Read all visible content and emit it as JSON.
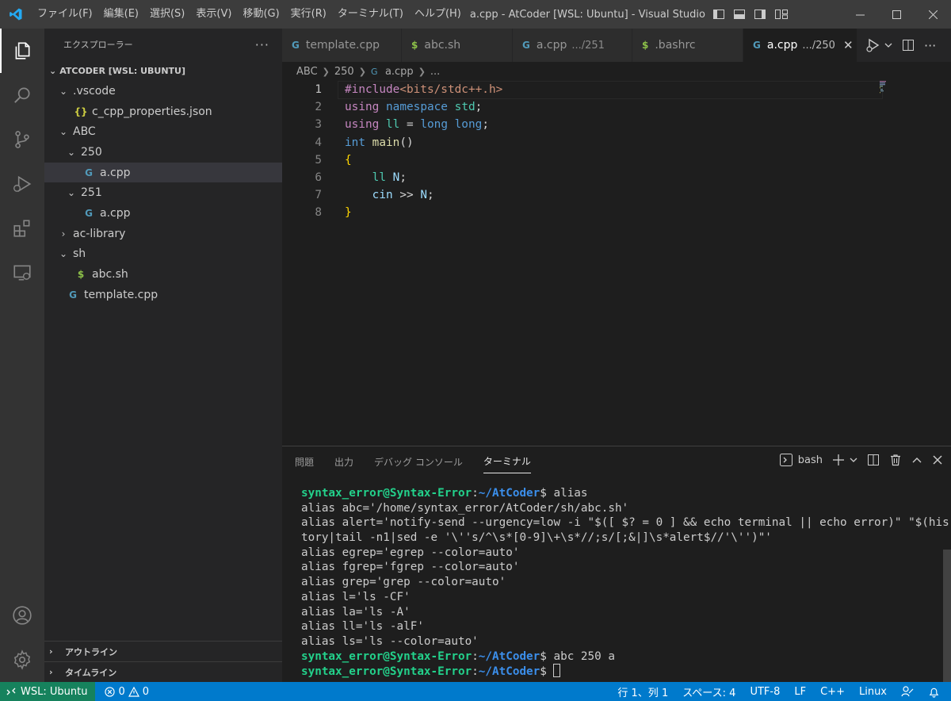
{
  "titlebar": {
    "menu": [
      "ファイル(F)",
      "編集(E)",
      "選択(S)",
      "表示(V)",
      "移動(G)",
      "実行(R)",
      "ターミナル(T)",
      "ヘルプ(H)"
    ],
    "title": "a.cpp - AtCoder [WSL: Ubuntu] - Visual Studio ..."
  },
  "activitybar": {
    "items": [
      "explorer-icon",
      "search-icon",
      "source-control-icon",
      "run-debug-icon",
      "extensions-icon",
      "remote-explorer-icon"
    ],
    "bottom": [
      "account-icon",
      "settings-gear-icon"
    ]
  },
  "sidebar": {
    "header": "エクスプローラー",
    "more": "···",
    "workspace": "ATCODER [WSL: UBUNTU]",
    "tree": [
      {
        "label": ".vscode",
        "indent": 1,
        "twist": "⌄",
        "icon": ""
      },
      {
        "label": "c_cpp_properties.json",
        "indent": 2,
        "twist": "",
        "icon": "{}"
      },
      {
        "label": "ABC",
        "indent": 1,
        "twist": "⌄",
        "icon": ""
      },
      {
        "label": "250",
        "indent": 2,
        "twist": "⌄",
        "icon": ""
      },
      {
        "label": "a.cpp",
        "indent": 3,
        "twist": "",
        "icon": "G"
      },
      {
        "label": "251",
        "indent": 2,
        "twist": "⌄",
        "icon": ""
      },
      {
        "label": "a.cpp",
        "indent": 3,
        "twist": "",
        "icon": "G"
      },
      {
        "label": "ac-library",
        "indent": 1,
        "twist": "›",
        "icon": ""
      },
      {
        "label": "sh",
        "indent": 1,
        "twist": "⌄",
        "icon": ""
      },
      {
        "label": "abc.sh",
        "indent": 2,
        "twist": "",
        "icon": "$"
      },
      {
        "label": "template.cpp",
        "indent": 1,
        "twist": "",
        "icon": "G"
      }
    ],
    "outline": "アウトライン",
    "timeline": "タイムライン"
  },
  "tabs": [
    {
      "label": "template.cpp",
      "desc": "",
      "icon": "G"
    },
    {
      "label": "abc.sh",
      "desc": "",
      "icon": "$"
    },
    {
      "label": "a.cpp",
      "desc": ".../251",
      "icon": "G"
    },
    {
      "label": ".bashrc",
      "desc": "",
      "icon": "$"
    },
    {
      "label": "a.cpp",
      "desc": ".../250",
      "icon": "G"
    }
  ],
  "breadcrumb": [
    "ABC",
    "250",
    "a.cpp",
    "..."
  ],
  "code": {
    "line_numbers": [
      "1",
      "2",
      "3",
      "4",
      "5",
      "6",
      "7",
      "8"
    ],
    "lines": [
      "#include <bits/stdc++.h>",
      "using namespace std;",
      "using ll = long long;",
      "int main()",
      "{",
      "    ll N;",
      "    cin >> N;",
      "}"
    ]
  },
  "panel": {
    "tabs": [
      "問題",
      "出力",
      "デバッグ コンソール",
      "ターミナル"
    ],
    "shell": "bash"
  },
  "terminal": {
    "prompt_user": "syntax_error@Syntax-Error",
    "prompt_path": "~/AtCoder",
    "cmd1": "alias",
    "output": [
      "alias abc='/home/syntax_error/AtCoder/sh/abc.sh'",
      "alias alert='notify-send --urgency=low -i \"$([ $? = 0 ] && echo terminal || echo error)\" \"$(his",
      "tory|tail -n1|sed -e '\\''s/^\\s*[0-9]\\+\\s*//;s/[;&|]\\s*alert$//'\\'')\"'",
      "alias egrep='egrep --color=auto'",
      "alias fgrep='fgrep --color=auto'",
      "alias grep='grep --color=auto'",
      "alias l='ls -CF'",
      "alias la='ls -A'",
      "alias ll='ls -alF'",
      "alias ls='ls --color=auto'"
    ],
    "cmd2": "abc 250 a"
  },
  "statusbar": {
    "remote": "WSL: Ubuntu",
    "errors": "0",
    "warnings": "0",
    "position": "行 1、列 1",
    "spaces": "スペース: 4",
    "encoding": "UTF-8",
    "eol": "LF",
    "language": "C++",
    "os": "Linux"
  },
  "colors": {
    "accent": "#007acc",
    "remote": "#16825d",
    "titlebar": "#3c3c3c"
  }
}
